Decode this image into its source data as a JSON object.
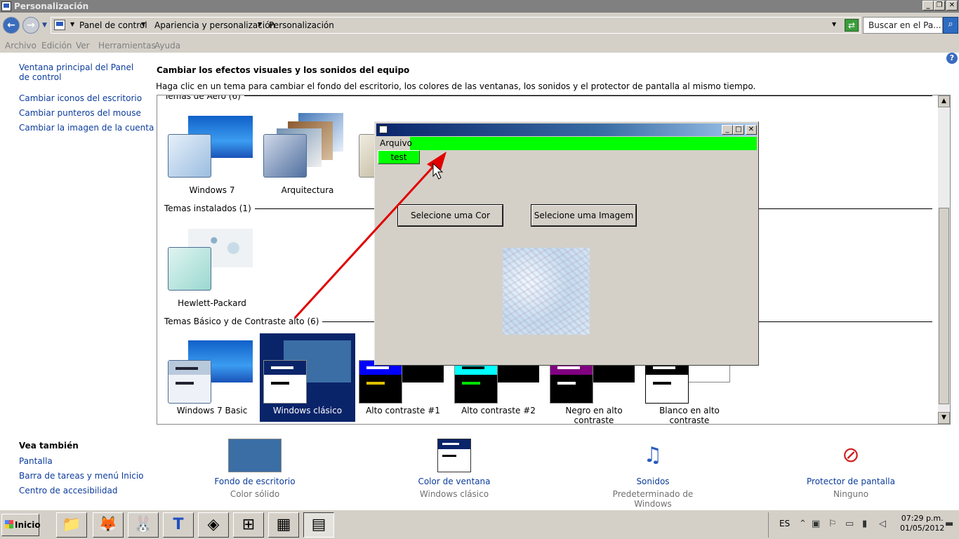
{
  "window": {
    "title": "Personalización"
  },
  "address": {
    "crumbs": [
      "Panel de control",
      "Apariencia y personalización",
      "Personalización"
    ],
    "search_placeholder": "Buscar en el Pa..."
  },
  "menu": [
    "Archivo",
    "Edición",
    "Ver",
    "Herramientas",
    "Ayuda"
  ],
  "sidebar": {
    "links": [
      "Ventana principal del Panel de control",
      "Cambiar iconos del escritorio",
      "Cambiar punteros del mouse",
      "Cambiar la imagen de la cuenta"
    ]
  },
  "main": {
    "heading": "Cambiar los efectos visuales y los sonidos del equipo",
    "description": "Haga clic en un tema para cambiar el fondo del escritorio, los colores de las ventanas, los sonidos y el protector de pantalla al mismo tiempo."
  },
  "groups": {
    "aero": "Temas de Aero (6)",
    "installed": "Temas instalados (1)",
    "basic": "Temas Básico y de Contraste alto (6)"
  },
  "themes": {
    "aero": [
      "Windows 7",
      "Arquitectura"
    ],
    "installed": [
      "Hewlett-Packard"
    ],
    "basic": [
      "Windows 7 Basic",
      "Windows clásico",
      "Alto contraste #1",
      "Alto contraste #2",
      "Negro en alto contraste",
      "Blanco en alto contraste"
    ],
    "selected": "Windows clásico"
  },
  "see_also": {
    "title": "Vea también",
    "links": [
      "Pantalla",
      "Barra de tareas y menú Inicio",
      "Centro de accesibilidad"
    ]
  },
  "bottom": {
    "items": [
      {
        "label": "Fondo de escritorio",
        "sub": "Color sólido"
      },
      {
        "label": "Color de ventana",
        "sub": "Windows clásico"
      },
      {
        "label": "Sonidos",
        "sub": "Predeterminado de Windows"
      },
      {
        "label": "Protector de pantalla",
        "sub": "Ninguno"
      }
    ]
  },
  "dialog": {
    "menu": "Arquivo",
    "popup_item": "test",
    "btn_color": "Selecione uma Cor",
    "btn_image": "Selecione uma Imagem",
    "menubar_color": "#00ff00"
  },
  "taskbar": {
    "start": "Inicio",
    "lang": "ES",
    "time": "07:29 p.m.",
    "date": "01/05/2012"
  },
  "colors": {
    "link": "#0c3c9c",
    "selected": "#0a246a",
    "arrow": "#e00000"
  }
}
